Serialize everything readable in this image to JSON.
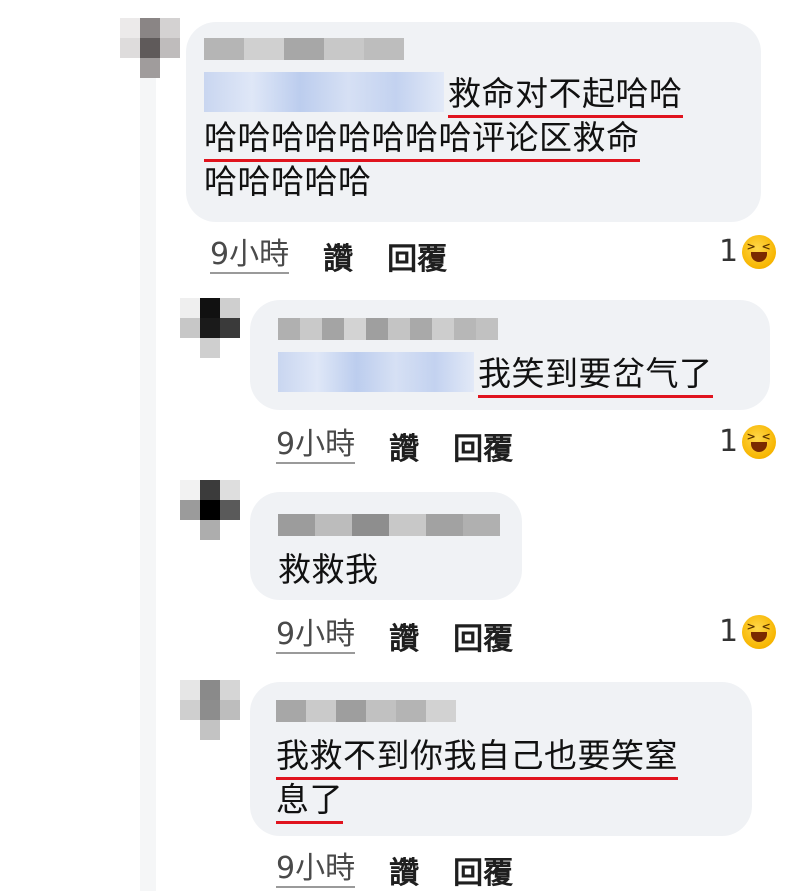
{
  "comments": [
    {
      "text_lines": [
        "救命对不起哈哈",
        "哈哈哈哈哈哈哈哈评论区救命",
        "哈哈哈哈哈"
      ],
      "time": "9小時",
      "like_label": "讚",
      "reply_label": "回覆",
      "reaction_count": "1",
      "reaction_icon": "laughing-emoji-icon"
    },
    {
      "text_lines": [
        "我笑到要岔气了"
      ],
      "time": "9小時",
      "like_label": "讚",
      "reply_label": "回覆",
      "reaction_count": "1",
      "reaction_icon": "laughing-emoji-icon"
    },
    {
      "text_lines": [
        "救救我"
      ],
      "time": "9小時",
      "like_label": "讚",
      "reply_label": "回覆",
      "reaction_count": "1",
      "reaction_icon": "laughing-emoji-icon"
    },
    {
      "text_lines": [
        "我救不到你我自己也要笑窒",
        "息了"
      ],
      "time": "9小時",
      "like_label": "讚",
      "reply_label": "回覆"
    }
  ],
  "colors": {
    "bubble": "#f0f2f5",
    "underline": "#e0141e",
    "emoji": "#f7b500"
  }
}
